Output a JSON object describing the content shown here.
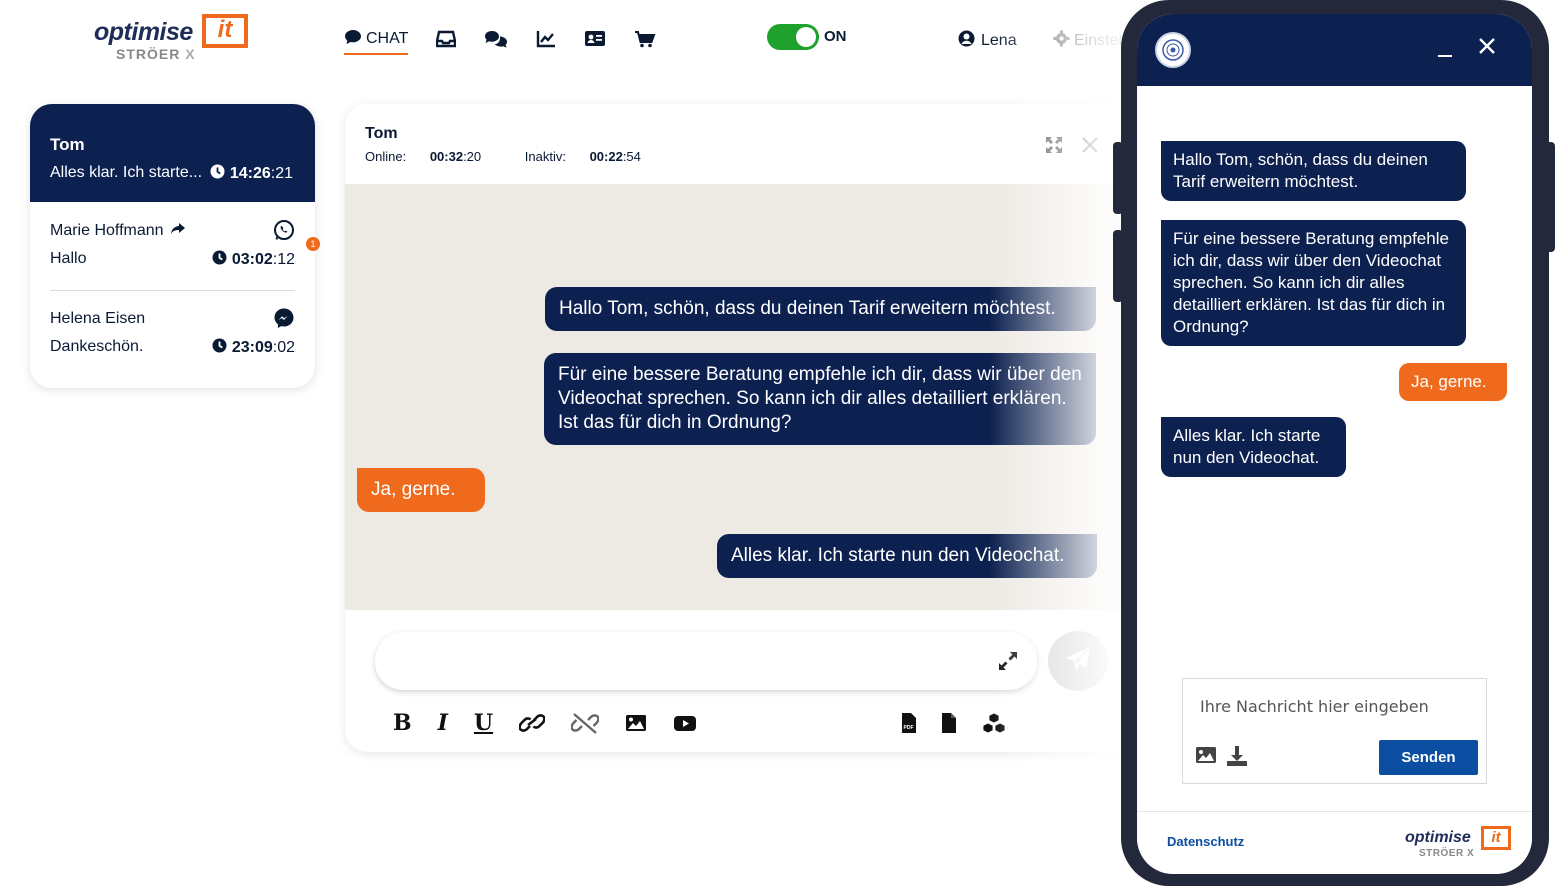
{
  "brand": {
    "word": "optimise",
    "it": "it",
    "sub": "STRÖER",
    "sub_x": "X"
  },
  "nav": {
    "chat_label": "CHAT",
    "icons": [
      "chat-bubble-icon",
      "inbox-icon",
      "comments-icon",
      "line-chart-icon",
      "id-card-icon",
      "cart-icon"
    ]
  },
  "status": {
    "toggle_label": "ON",
    "on": true,
    "color": "#1fa12e"
  },
  "user": {
    "name": "Lena"
  },
  "settings": {
    "label": "Einstel"
  },
  "conversations": {
    "active": {
      "name": "Tom",
      "preview": "Alles klar. Ich starte...",
      "time_bold": "14:26",
      "time_rest": ":21"
    },
    "items": [
      {
        "name": "Marie Hoffmann",
        "preview": "Hallo",
        "time_bold": "03:02",
        "time_rest": ":12",
        "channel": "whatsapp-icon",
        "badge": "1"
      },
      {
        "name": "Helena Eisen",
        "preview": "Dankeschön.",
        "time_bold": "23:09",
        "time_rest": ":02",
        "channel": "messenger-icon"
      }
    ]
  },
  "chat": {
    "header_name": "Tom",
    "online_label": "Online: ",
    "online_bold": "00:32",
    "online_rest": ":20",
    "inactive_label": "Inaktiv: ",
    "inactive_bold": "00:22",
    "inactive_rest": ":54",
    "messages": [
      {
        "from": "agent",
        "text": "Hallo Tom, schön, dass du deinen Tarif erweitern möchtest."
      },
      {
        "from": "agent",
        "text": "Für eine bessere Beratung empfehle ich dir, dass wir über den Videochat sprechen. So kann ich dir alles detailliert erklären. Ist das für dich in Ordnung?"
      },
      {
        "from": "customer",
        "text": "Ja, gerne."
      },
      {
        "from": "agent",
        "text": "Alles klar. Ich starte nun den Videochat."
      }
    ],
    "composer_value": "",
    "toolbar": {
      "bold": "B",
      "italic": "I",
      "underline": "U"
    }
  },
  "phone": {
    "messages": [
      {
        "from": "agent",
        "text": "Hallo Tom, schön, dass du deinen Tarif erweitern möchtest."
      },
      {
        "from": "agent",
        "text": "Für eine bessere Beratung empfehle ich dir, dass wir über den Videochat sprechen. So kann ich dir alles detailliert erklären. Ist das für dich in Ordnung?"
      },
      {
        "from": "customer",
        "text": "Ja, gerne."
      },
      {
        "from": "agent",
        "text": "Alles klar. Ich starte nun den Videochat."
      }
    ],
    "input_placeholder": "Ihre Nachricht hier eingeben",
    "send_label": "Senden",
    "footer_link": "Datenschutz"
  },
  "colors": {
    "navy": "#0d2150",
    "orange": "#ef6a1c",
    "chat_bg": "#ede9e3",
    "send_blue": "#0b4ea2"
  }
}
